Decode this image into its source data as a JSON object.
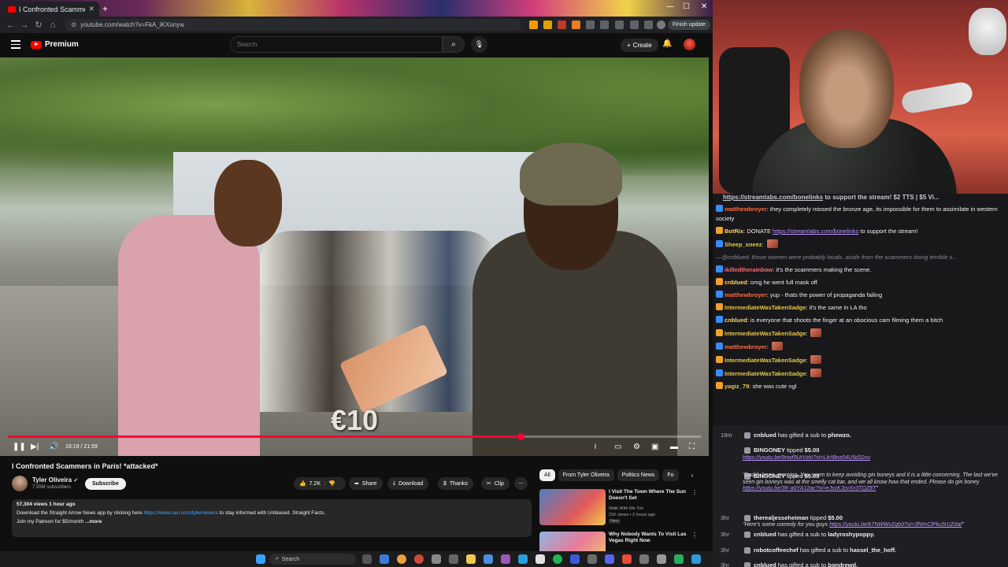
{
  "browser": {
    "tab_title": "I Confronted Scammers in P",
    "url": "youtube.com/watch?v=FkA_iKXonyw",
    "finish_update": "Finish update"
  },
  "youtube": {
    "logo_text": "Premium",
    "search_placeholder": "Search",
    "create_label": "Create"
  },
  "video": {
    "overlay_price": "€10",
    "time": "16:19 / 21:59",
    "progress": 0.74,
    "title": "I Confronted Scammers in Paris! *attacked*",
    "channel": "Tyler Oliveira",
    "subscribers": "7.55M subscribers",
    "subscribe_label": "Subscribe",
    "likes": "7.2K",
    "share_label": "Share",
    "download_label": "Download",
    "thanks_label": "Thanks",
    "clip_label": "Clip",
    "meta": "57,304 views  1 hour ago",
    "desc_line1_pre": "Download the Straight Arrow News app by clicking here ",
    "desc_line1_link": "https://www.san.com/tyleroliveira",
    "desc_line1_post": " to stay informed with Unbiased. Straight Facts.",
    "desc_line2": "Join my Patreon for $5/month",
    "desc_more": "...more"
  },
  "recommendations": {
    "chips": [
      "All",
      "From Tyler Oliveira",
      "Politics News",
      "Fo"
    ],
    "items": [
      {
        "title": "I Visit The Town Where The Sun Doesn't Set",
        "channel": "Walk With Me Tim",
        "stats": "21K views • 2 hours ago",
        "badge": "New"
      },
      {
        "title": "Why Nobody Wants To Visit Las Vegas Right Now",
        "channel": "",
        "stats": "",
        "badge": ""
      }
    ]
  },
  "taskbar": {
    "search_label": "Search"
  },
  "chat": {
    "ticker_pre": "https://streamlabs.com/bonelinks",
    "ticker_post": " to support the stream! $2 TTS | $5 Vi...",
    "messages": [
      {
        "user": "matthewbroyer",
        "color": "#ff6b3d",
        "text": ": they completely missed the bronze age, its impossible for them to assimilate in western society"
      },
      {
        "user": "BotRix",
        "color": "#ffd166",
        "text": ": DONATE ",
        "link": "https://streamlabs.com/bonelinks",
        "after": " to support the stream!"
      },
      {
        "user": "Sheep_sneez",
        "color": "#e6c84a",
        "text": ":"
      },
      {
        "muted": "—@cnblued: those women were probably locals. aside from the scammers doing terrible s..."
      },
      {
        "user": "ikilledtherainbow",
        "color": "#ff6b6b",
        "text": ": it's the scammers making the scene."
      },
      {
        "user": "cnblued",
        "color": "#ffd166",
        "text": ": omg he went full mask off"
      },
      {
        "user": "matthewbroyer",
        "color": "#ff6b3d",
        "text": ": yup - thats the power of propaganda failing"
      },
      {
        "user": "IntermediateWasTakenSadge",
        "color": "#e6c84a",
        "text": ": it's the same in LA tho"
      },
      {
        "user": "cnblued",
        "color": "#ffd166",
        "text": ": is everyone that shoots the finger at an obocious cam filming them a bitch"
      },
      {
        "user": "IntermediateWasTakenSadge",
        "color": "#e6c84a",
        "text": ":"
      },
      {
        "user": "matthewbroyer",
        "color": "#ff6b3d",
        "text": ":"
      },
      {
        "user": "IntermediateWasTakenSadge",
        "color": "#e6c84a",
        "text": ":"
      },
      {
        "user": "IntermediateWasTakenSadge",
        "color": "#e6c84a",
        "text": ":"
      },
      {
        "user": "yagiz_79",
        "color": "#e6c84a",
        "text": ": she was cute ngl"
      }
    ]
  },
  "alerts": [
    {
      "time": "19m",
      "text_pre": "cnblued",
      "text_post": " has gifted a sub to ",
      "target": "phewzo."
    },
    {
      "time": "",
      "text_pre": "BINGONEY",
      "text_post": " tipped ",
      "target": "$5.00",
      "msg_link": "https://youtu.be/9nwf9UrVzkI?si=LkrIBnz04U5d32vu"
    },
    {
      "time": "",
      "text_pre": "BINGONEY",
      "text_post": " tipped ",
      "target": "$5.00",
      "msg": "\"Daddy bone, morning. You seem to keep avoiding gin boneys and it is a little concerning. The last we've seen gin boneys was at the smelly cat bar, and we all know how that ended. Please do gin boney ",
      "msg_link": "https://youtu.be/3K-a0YA12ac?si=eJscKJcvXx3TQZ8T",
      "msg_after": "\""
    },
    {
      "time": "3hr",
      "text_pre": "therealjesseheiman",
      "text_post": " tipped ",
      "target": "$5.00",
      "msg": "\"Here's some comedy for you guys ",
      "msg_link": "https://youtu.be/k7NWWvZgb0?si=3fWnClPku5rUZdaf",
      "msg_after": "\""
    },
    {
      "time": "3hr",
      "text_pre": "cnblued",
      "text_post": " has gifted a sub to ",
      "target": "ladyroshypoppy."
    },
    {
      "time": "3hr",
      "text_pre": "robotcoffeechef",
      "text_post": " has gifted a sub to ",
      "target": "hassel_the_hoff."
    },
    {
      "time": "3hr",
      "text_pre": "cnblued",
      "text_post": " has gifted a sub to ",
      "target": "bondrewd."
    }
  ]
}
